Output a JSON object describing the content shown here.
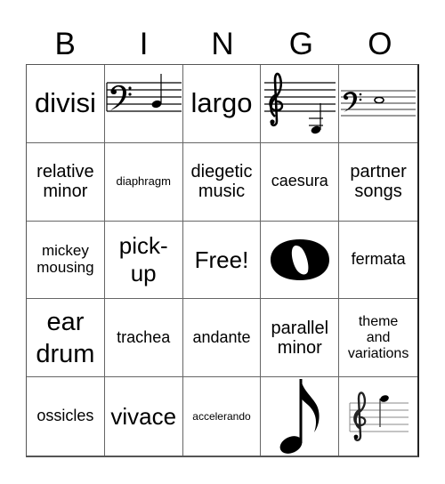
{
  "header": {
    "letters": [
      "B",
      "I",
      "N",
      "G",
      "O"
    ]
  },
  "cells": [
    {
      "text": "divisi",
      "type": "text"
    },
    {
      "text": "",
      "type": "image",
      "icon": "bass-clef-quarter-note-icon"
    },
    {
      "text": "largo",
      "type": "text"
    },
    {
      "text": "",
      "type": "image",
      "icon": "treble-clef-low-note-icon"
    },
    {
      "text": "",
      "type": "image",
      "icon": "bass-clef-whole-note-icon"
    },
    {
      "text": "relative minor",
      "lines": [
        "relative",
        "minor"
      ],
      "type": "text"
    },
    {
      "text": "diaphragm",
      "type": "text"
    },
    {
      "text": "diegetic music",
      "lines": [
        "diegetic",
        "music"
      ],
      "type": "text"
    },
    {
      "text": "caesura",
      "type": "text"
    },
    {
      "text": "partner songs",
      "lines": [
        "partner",
        "songs"
      ],
      "type": "text"
    },
    {
      "text": "mickey mousing",
      "lines": [
        "mickey",
        "mousing"
      ],
      "type": "text"
    },
    {
      "text": "pick-up",
      "lines": [
        "pick-",
        "up"
      ],
      "type": "text"
    },
    {
      "text": "Free!",
      "type": "free"
    },
    {
      "text": "",
      "type": "image",
      "icon": "whole-note-icon"
    },
    {
      "text": "fermata",
      "type": "text"
    },
    {
      "text": "ear drum",
      "lines": [
        "ear",
        "drum"
      ],
      "type": "text"
    },
    {
      "text": "trachea",
      "type": "text"
    },
    {
      "text": "andante",
      "type": "text"
    },
    {
      "text": "parallel minor",
      "lines": [
        "parallel",
        "minor"
      ],
      "type": "text"
    },
    {
      "text": "theme and variations",
      "lines": [
        "theme",
        "and",
        "variations"
      ],
      "type": "text"
    },
    {
      "text": "ossicles",
      "type": "text"
    },
    {
      "text": "vivace",
      "type": "text"
    },
    {
      "text": "accelerando",
      "type": "text"
    },
    {
      "text": "",
      "type": "image",
      "icon": "eighth-note-icon"
    },
    {
      "text": "",
      "type": "image",
      "icon": "treble-clef-high-note-icon"
    }
  ]
}
